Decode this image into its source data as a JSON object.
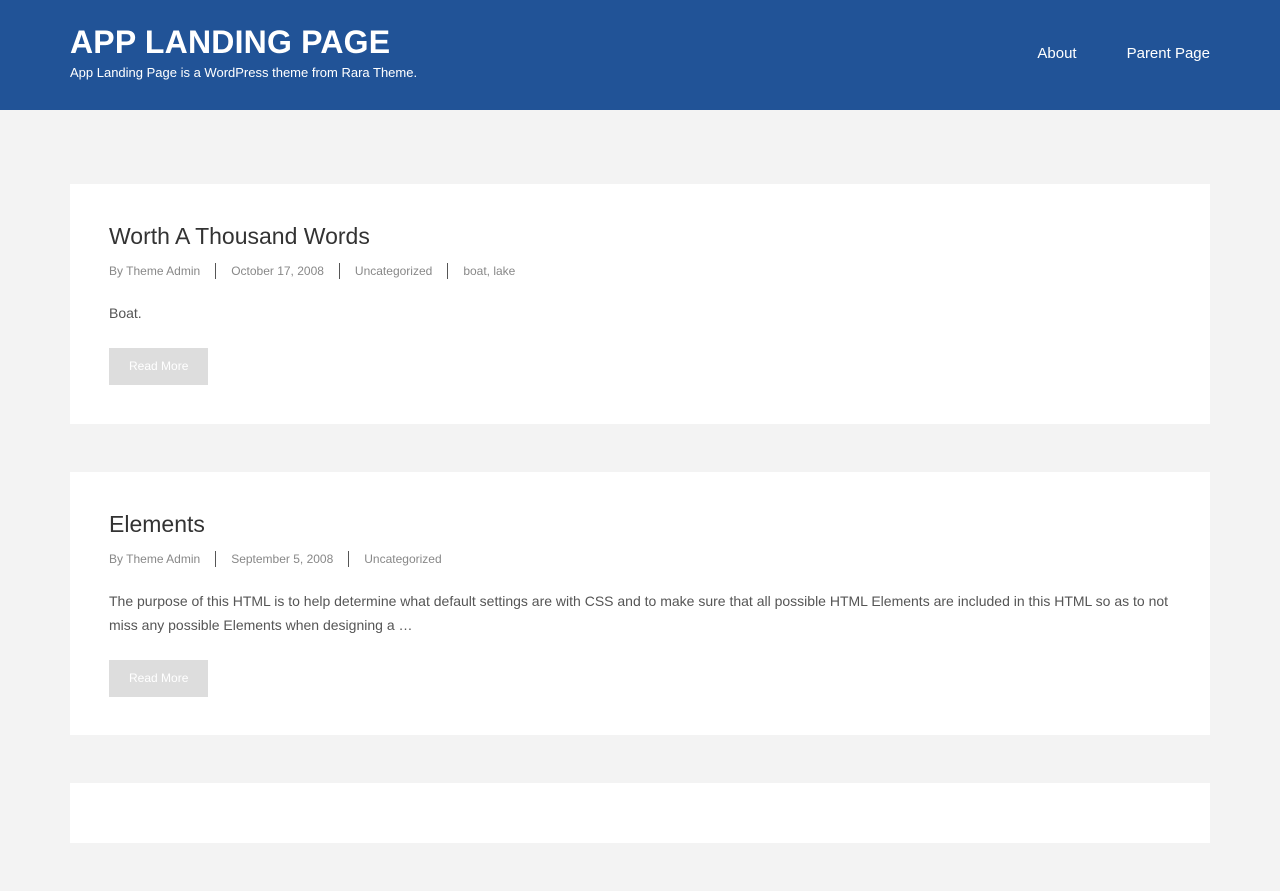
{
  "header": {
    "site_title": "APP LANDING PAGE",
    "site_description": "App Landing Page is a WordPress theme from Rara Theme.",
    "nav": [
      {
        "label": "About"
      },
      {
        "label": "Parent Page"
      }
    ]
  },
  "posts": [
    {
      "title": "Worth A Thousand Words",
      "author_prefix": "By",
      "author": "Theme Admin",
      "date": "October 17, 2008",
      "category": "Uncategorized",
      "tags": "boat, lake",
      "excerpt": "Boat.",
      "read_more": "Read More"
    },
    {
      "title": "Elements",
      "author_prefix": "By",
      "author": "Theme Admin",
      "date": "September 5, 2008",
      "category": "Uncategorized",
      "excerpt": "The purpose of this HTML is to help determine what default settings are with CSS and to make sure that all possible HTML Elements are included in this HTML so as to not miss any possible Elements when designing a …",
      "read_more": "Read More"
    }
  ],
  "colors": {
    "header_bg": "#215397",
    "page_bg": "#f3f3f3",
    "button_bg": "#dddddd"
  }
}
